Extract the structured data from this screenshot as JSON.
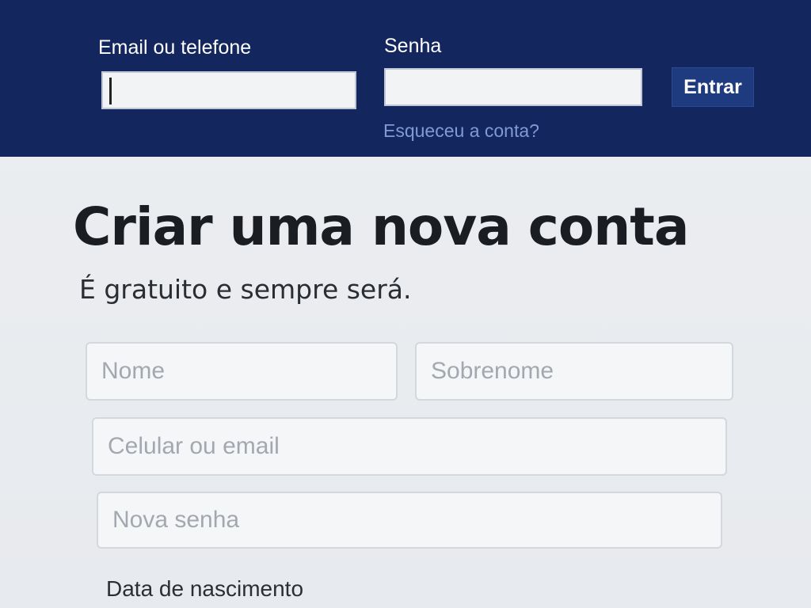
{
  "header": {
    "email_label": "Email ou telefone",
    "email_value": "",
    "password_label": "Senha",
    "password_value": "",
    "login_button": "Entrar",
    "forgot_link": "Esqueceu a conta?"
  },
  "signup": {
    "title": "Criar uma nova conta",
    "subtitle": "É gratuito e sempre será.",
    "first_name_placeholder": "Nome",
    "last_name_placeholder": "Sobrenome",
    "contact_placeholder": "Celular ou email",
    "new_password_placeholder": "Nova senha",
    "birthday_label": "Data de nascimento"
  },
  "colors": {
    "header_bg": "#14265e",
    "page_bg": "#e9ebee",
    "link": "#7f9bd2",
    "button_bg": "#1f3b80"
  }
}
